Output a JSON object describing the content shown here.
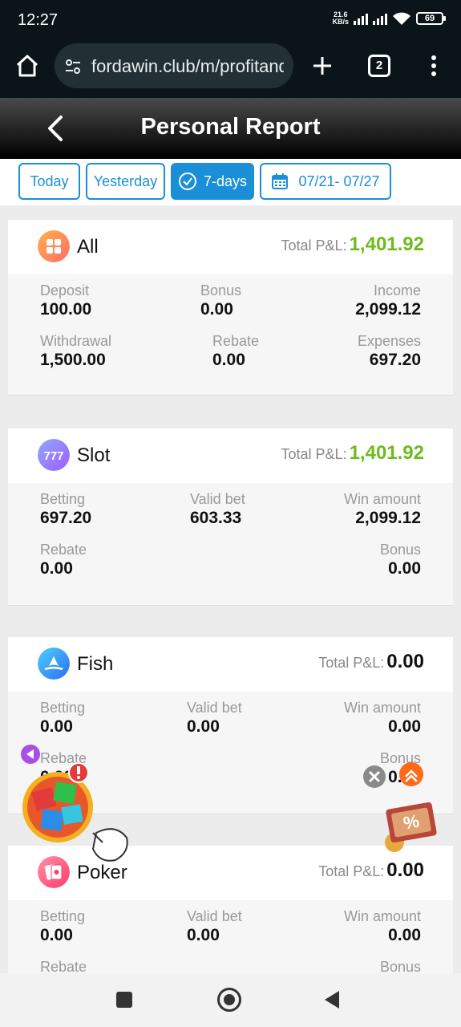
{
  "status": {
    "time": "12:27",
    "net_speed_value": "21.6",
    "net_speed_unit": "KB/s",
    "battery": "69"
  },
  "browser": {
    "url": "fordawin.club/m/profitandloss",
    "tab_count": "2"
  },
  "header": {
    "title": "Personal Report"
  },
  "filters": {
    "today": "Today",
    "yesterday": "Yesterday",
    "seven_days": "7-days",
    "range": "07/21- 07/27",
    "selected": "7-days"
  },
  "pnl_label": "Total P&L:",
  "cards": {
    "all": {
      "name": "All",
      "total_pnl": "1,401.92",
      "deposit_label": "Deposit",
      "deposit": "100.00",
      "bonus_label": "Bonus",
      "bonus": "0.00",
      "income_label": "Income",
      "income": "2,099.12",
      "withdrawal_label": "Withdrawal",
      "withdrawal": "1,500.00",
      "rebate_label": "Rebate",
      "rebate": "0.00",
      "expenses_label": "Expenses",
      "expenses": "697.20"
    },
    "slot": {
      "name": "Slot",
      "total_pnl": "1,401.92",
      "betting_label": "Betting",
      "betting": "697.20",
      "valid_bet_label": "Valid bet",
      "valid_bet": "603.33",
      "win_amount_label": "Win amount",
      "win_amount": "2,099.12",
      "rebate_label": "Rebate",
      "rebate": "0.00",
      "bonus_label": "Bonus",
      "bonus": "0.00"
    },
    "fish": {
      "name": "Fish",
      "total_pnl": "0.00",
      "betting_label": "Betting",
      "betting": "0.00",
      "valid_bet_label": "Valid bet",
      "valid_bet": "0.00",
      "win_amount_label": "Win amount",
      "win_amount": "0.00",
      "rebate_label": "Rebate",
      "rebate": "0.00",
      "bonus_label": "Bonus",
      "bonus": "0.00"
    },
    "poker": {
      "name": "Poker",
      "total_pnl": "0.00",
      "betting_label": "Betting",
      "betting": "0.00",
      "valid_bet_label": "Valid bet",
      "valid_bet": "0.00",
      "win_amount_label": "Win amount",
      "win_amount": "0.00",
      "rebate_label": "Rebate",
      "bonus_label": "Bonus"
    }
  },
  "colors": {
    "accent": "#1a8fd8",
    "profit": "#6cbc1c",
    "header_dark": "#000000"
  },
  "icons": [
    "home-icon",
    "tune-icon",
    "plus-icon",
    "tabs-icon",
    "menu-icon",
    "back-icon",
    "check-icon",
    "calendar-icon",
    "all-icon",
    "slot-icon",
    "fish-icon",
    "poker-icon",
    "close-icon",
    "scroll-top-icon"
  ]
}
